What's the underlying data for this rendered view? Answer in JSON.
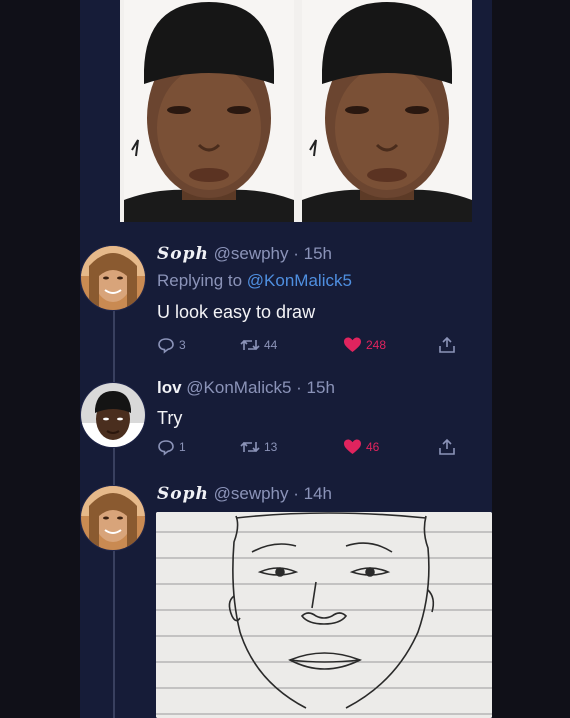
{
  "tweets": [
    {
      "name": "Soph",
      "handle": "@sewphy",
      "time": "15h",
      "replying_prefix": "Replying to",
      "replying_to": "@KonMalick5",
      "text": "U look easy to draw",
      "replies": "3",
      "retweets": "44",
      "likes": "248"
    },
    {
      "name": "lov",
      "handle": "@KonMalick5",
      "time": "15h",
      "text": "Try",
      "replies": "1",
      "retweets": "13",
      "likes": "46"
    },
    {
      "name": "Soph",
      "handle": "@sewphy",
      "time": "14h"
    }
  ],
  "separator": " · ",
  "colors": {
    "panel": "#161c38",
    "muted": "#8b93b8",
    "mention": "#4f8fe0",
    "like": "#e0245e"
  },
  "icons": [
    "reply-icon",
    "retweet-icon",
    "heart-icon",
    "share-icon"
  ]
}
